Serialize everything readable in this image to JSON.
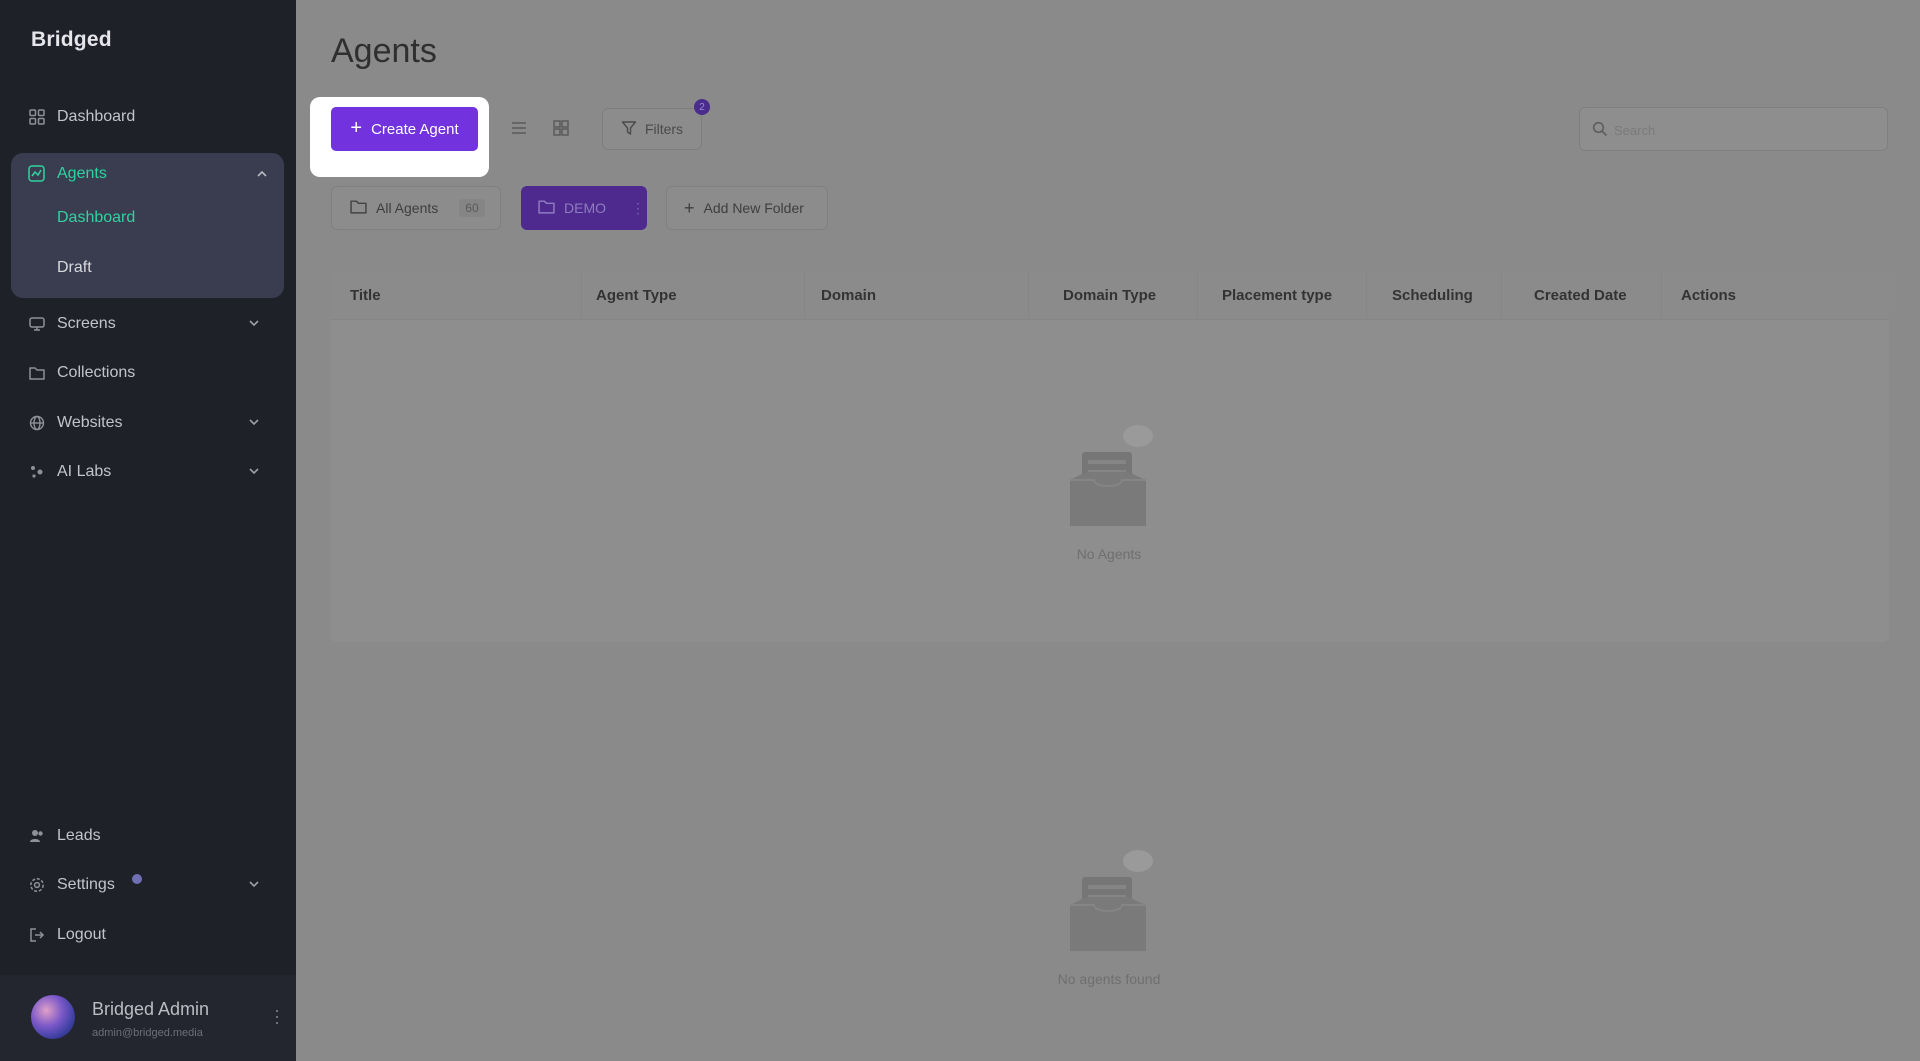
{
  "app": {
    "logo": "Bridged"
  },
  "sidebar": {
    "items": [
      {
        "label": "Dashboard",
        "icon": "grid-icon"
      },
      {
        "label": "Agents",
        "icon": "chart-icon",
        "expanded": true,
        "children": [
          {
            "label": "Dashboard",
            "active": true
          },
          {
            "label": "Draft"
          }
        ]
      },
      {
        "label": "Screens",
        "icon": "monitor-icon"
      },
      {
        "label": "Collections",
        "icon": "folder-icon"
      },
      {
        "label": "Websites",
        "icon": "globe-icon"
      },
      {
        "label": "AI Labs",
        "icon": "sparkle-icon"
      }
    ],
    "bottom": [
      {
        "label": "Leads",
        "icon": "users-icon"
      },
      {
        "label": "Settings",
        "icon": "gear-icon"
      },
      {
        "label": "Logout",
        "icon": "logout-icon"
      }
    ],
    "user": {
      "name": "Bridged Admin",
      "email": "admin@bridged.media"
    }
  },
  "main": {
    "title": "Agents",
    "create_label": "Create Agent",
    "filters_label": "Filters",
    "filters_count": "2",
    "search_placeholder": "Search",
    "folders": {
      "all_label": "All Agents",
      "all_count": "60",
      "demo_label": "DEMO",
      "add_label": "Add New Folder"
    },
    "table": {
      "columns": [
        "Title",
        "Agent Type",
        "Domain",
        "Domain Type",
        "Placement type",
        "Scheduling",
        "Created Date",
        "Actions"
      ],
      "empty_label": "No Agents"
    },
    "empty_label_2": "No agents found"
  },
  "colors": {
    "accent": "#7232dd",
    "active_green": "#2fd3a0",
    "sidebar_bg": "#1f2129"
  }
}
